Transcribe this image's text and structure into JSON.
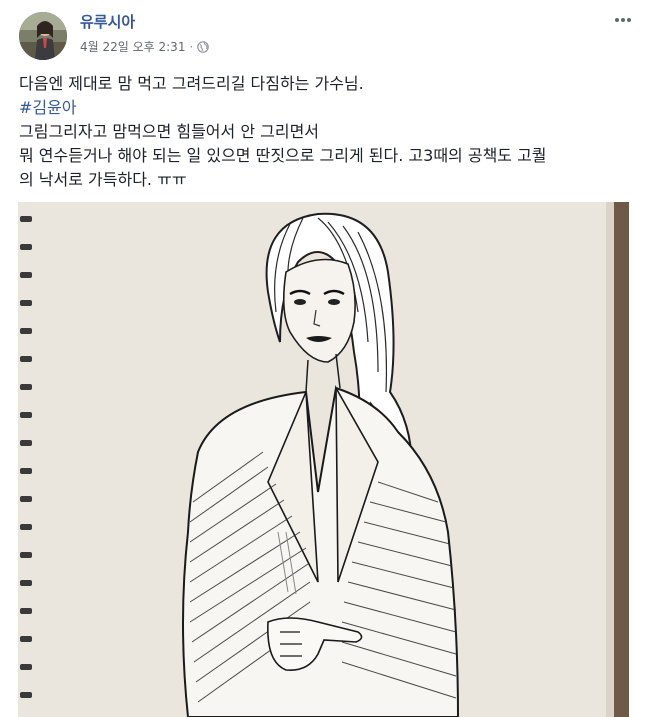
{
  "post": {
    "author": "유루시아",
    "timestamp": "4월 22일 오후 2:31",
    "separator": "·",
    "privacy_icon": "globe-icon",
    "more_icon": "more-options-icon",
    "lines": [
      "다음엔 제대로 맘 먹고 그려드리길 다짐하는 가수님.",
      "#김윤아",
      "그림그리자고 맘먹으면 힘들어서 안 그리면서",
      "뭐 연수듣거나 해야 되는 일 있으면 딴짓으로 그리게 된다. 고3때의 공책도 고퀄",
      "의 낙서로 가득하다. ㅠㅠ"
    ]
  },
  "colors": {
    "link": "#365899",
    "text": "#1d2129",
    "meta": "#616770"
  }
}
